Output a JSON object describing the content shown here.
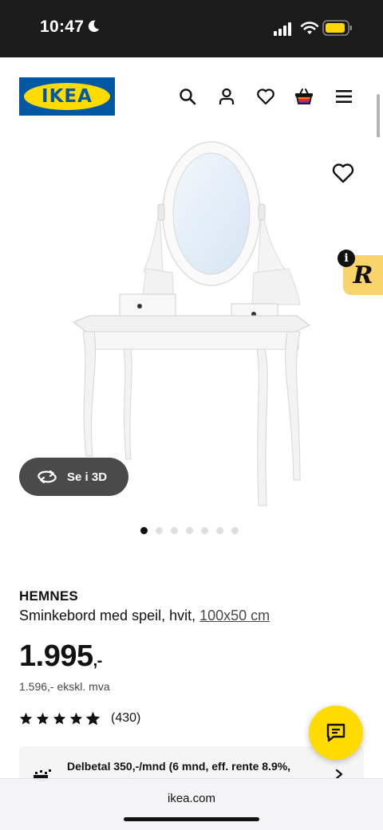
{
  "status_bar": {
    "time": "10:47",
    "icons": [
      "moon-icon",
      "cellular-signal-icon",
      "wifi-icon",
      "battery-icon"
    ]
  },
  "header": {
    "logo_text": "IKEA",
    "icons": [
      "search-icon",
      "user-icon",
      "heart-icon",
      "shopping-bag-icon",
      "hamburger-menu-icon"
    ]
  },
  "gallery": {
    "view_3d_label": "Se i 3D",
    "badge_letter": "R",
    "info_letter": "i",
    "page_count": 7,
    "active_page": 1
  },
  "product": {
    "name": "HEMNES",
    "description": "Sminkebord med speil, hvit, ",
    "size": "100x50 cm",
    "price": "1.995",
    "price_suffix": ",-",
    "price_ex_vat": "1.596,- ekskl. mva",
    "rating_stars": 4.5,
    "rating_count": "(430)"
  },
  "installment": {
    "text": "Delbetal 350,-/mnd (6 mnd, eff. rente 8.9%,"
  },
  "browser": {
    "url": "ikea.com"
  },
  "colors": {
    "ikea_blue": "#0058a3",
    "ikea_yellow": "#ffdb00",
    "badge_yellow": "#f8d46a",
    "button_dark": "#4a4a4a"
  }
}
